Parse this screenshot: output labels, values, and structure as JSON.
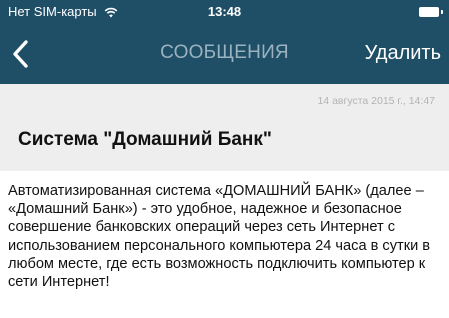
{
  "status_bar": {
    "carrier": "Нет SIM-карты",
    "time": "13:48"
  },
  "nav": {
    "title": "СООБЩЕНИЯ",
    "delete_label": "Удалить"
  },
  "message": {
    "date": "14 августа 2015 г., 14:47",
    "title": "Система \"Домашний Банк\"",
    "body": "Автоматизированная система «ДОМАШНИЙ БАНК» (далее – «Домашний Банк») - это удобное, надежное и безопасное совершение банковских операций через сеть Интернет с использованием персонального компьютера 24 часа в сутки в любом месте, где есть возможность подключить компьютер к сети Интернет!"
  },
  "colors": {
    "nav_background": "#1f4f66",
    "header_background": "#eeeeee",
    "title_muted": "#9bb2c0"
  }
}
